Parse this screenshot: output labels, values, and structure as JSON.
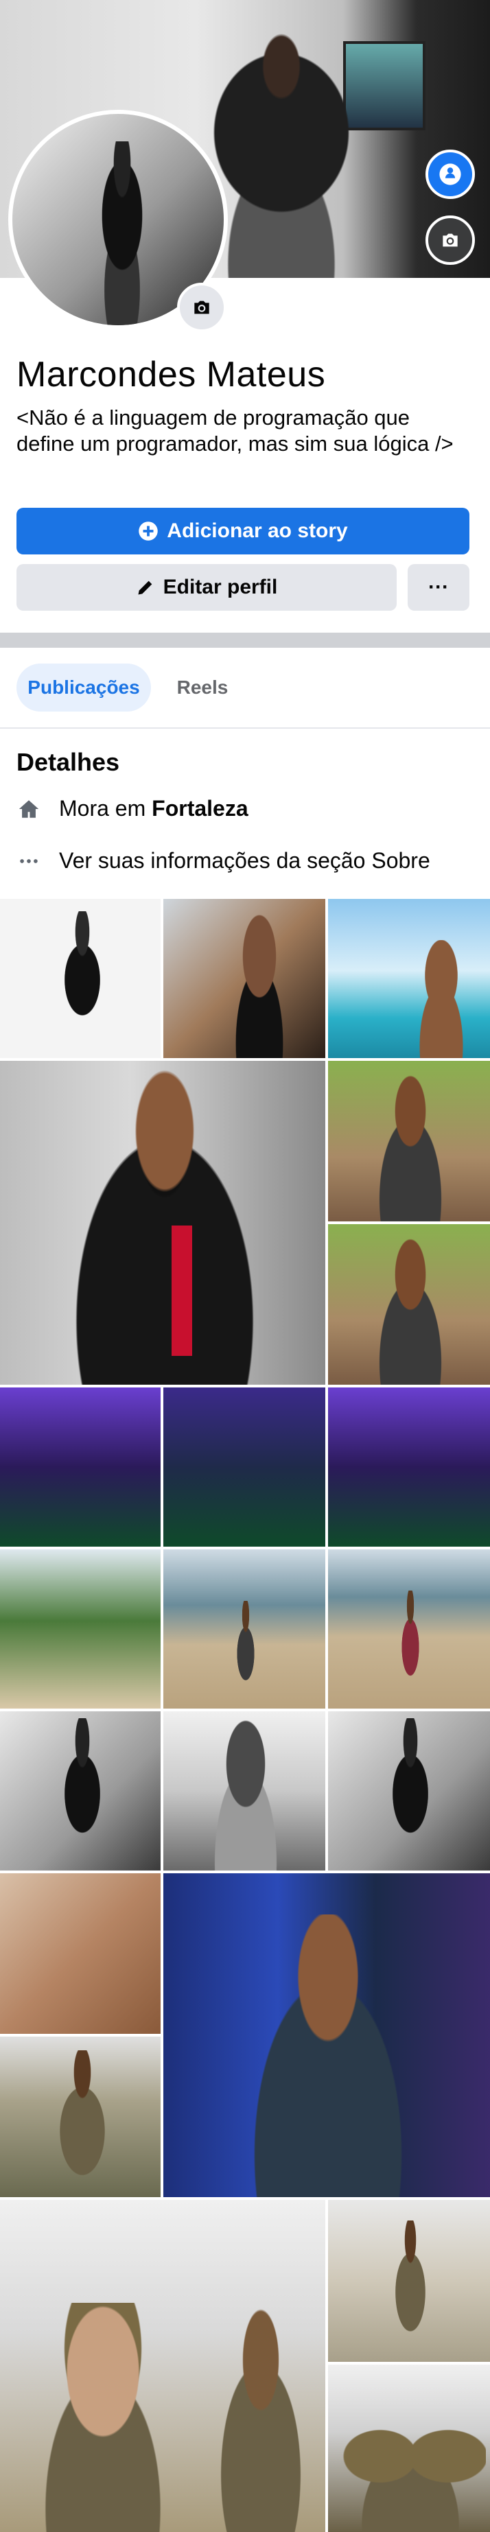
{
  "profile": {
    "name": "Marcondes Mateus",
    "bio": "<Não é a linguagem de programação que define um programador, mas sim sua lógica />"
  },
  "actions": {
    "add_story": "Adicionar ao story",
    "edit_profile": "Editar perfil",
    "more": "···"
  },
  "tabs": [
    {
      "label": "Publicações",
      "active": true
    },
    {
      "label": "Reels",
      "active": false
    }
  ],
  "details": {
    "title": "Detalhes",
    "lives_prefix": "Mora em",
    "lives_city": "Fortaleza",
    "about_link": "Ver suas informações da seção Sobre"
  },
  "colors": {
    "accent": "#1b74e4",
    "button_gray": "#e4e6eb",
    "tab_active_bg": "#e7f0fd"
  },
  "icons": {
    "story": "plus-circle-icon",
    "edit": "pencil-icon",
    "home": "home-icon",
    "more": "ellipsis-icon",
    "camera": "camera-icon"
  }
}
